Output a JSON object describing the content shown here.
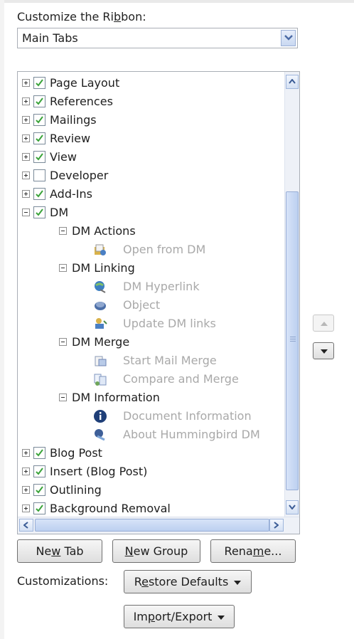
{
  "heading": {
    "text_pre": "Customize the Ri",
    "text_key": "b",
    "text_post": "bon:"
  },
  "combo": {
    "value": "Main Tabs"
  },
  "tree": {
    "items": [
      {
        "label": "Page Layout",
        "checked": true
      },
      {
        "label": "References",
        "checked": true
      },
      {
        "label": "Mailings",
        "checked": true
      },
      {
        "label": "Review",
        "checked": true
      },
      {
        "label": "View",
        "checked": true
      },
      {
        "label": "Developer",
        "checked": false
      },
      {
        "label": "Add-Ins",
        "checked": true
      },
      {
        "label": "DM",
        "checked": true
      }
    ],
    "dm_groups": [
      {
        "label": "DM Actions"
      },
      {
        "label": "Open from DM"
      },
      {
        "label": "DM Linking"
      },
      {
        "label": "DM Hyperlink"
      },
      {
        "label": "Object"
      },
      {
        "label": "Update DM links"
      },
      {
        "label": "DM Merge"
      },
      {
        "label": "Start Mail Merge"
      },
      {
        "label": "Compare and Merge"
      },
      {
        "label": "DM Information"
      },
      {
        "label": "Document Information"
      },
      {
        "label": "About Hummingbird DM"
      }
    ],
    "items_after": [
      {
        "label": "Blog Post",
        "checked": true
      },
      {
        "label": "Insert (Blog Post)",
        "checked": true
      },
      {
        "label": "Outlining",
        "checked": true
      },
      {
        "label": "Background Removal",
        "checked": true
      }
    ]
  },
  "buttons": {
    "new_tab_pre": "Ne",
    "new_tab_key": "w",
    "new_tab_post": " Tab",
    "new_group_pre": "",
    "new_group_key": "N",
    "new_group_post": "ew Group",
    "rename_pre": "Rena",
    "rename_key": "m",
    "rename_post": "e...",
    "customizations_label": "Customizations:",
    "restore_pre": "R",
    "restore_key": "e",
    "restore_post": "store Defaults",
    "import_pre": "Im",
    "import_key": "p",
    "import_post": "ort/Export"
  },
  "colors": {
    "check": "#3aa33a",
    "accent": "#3b6fb8",
    "dim_text": "#a9a9a9"
  }
}
